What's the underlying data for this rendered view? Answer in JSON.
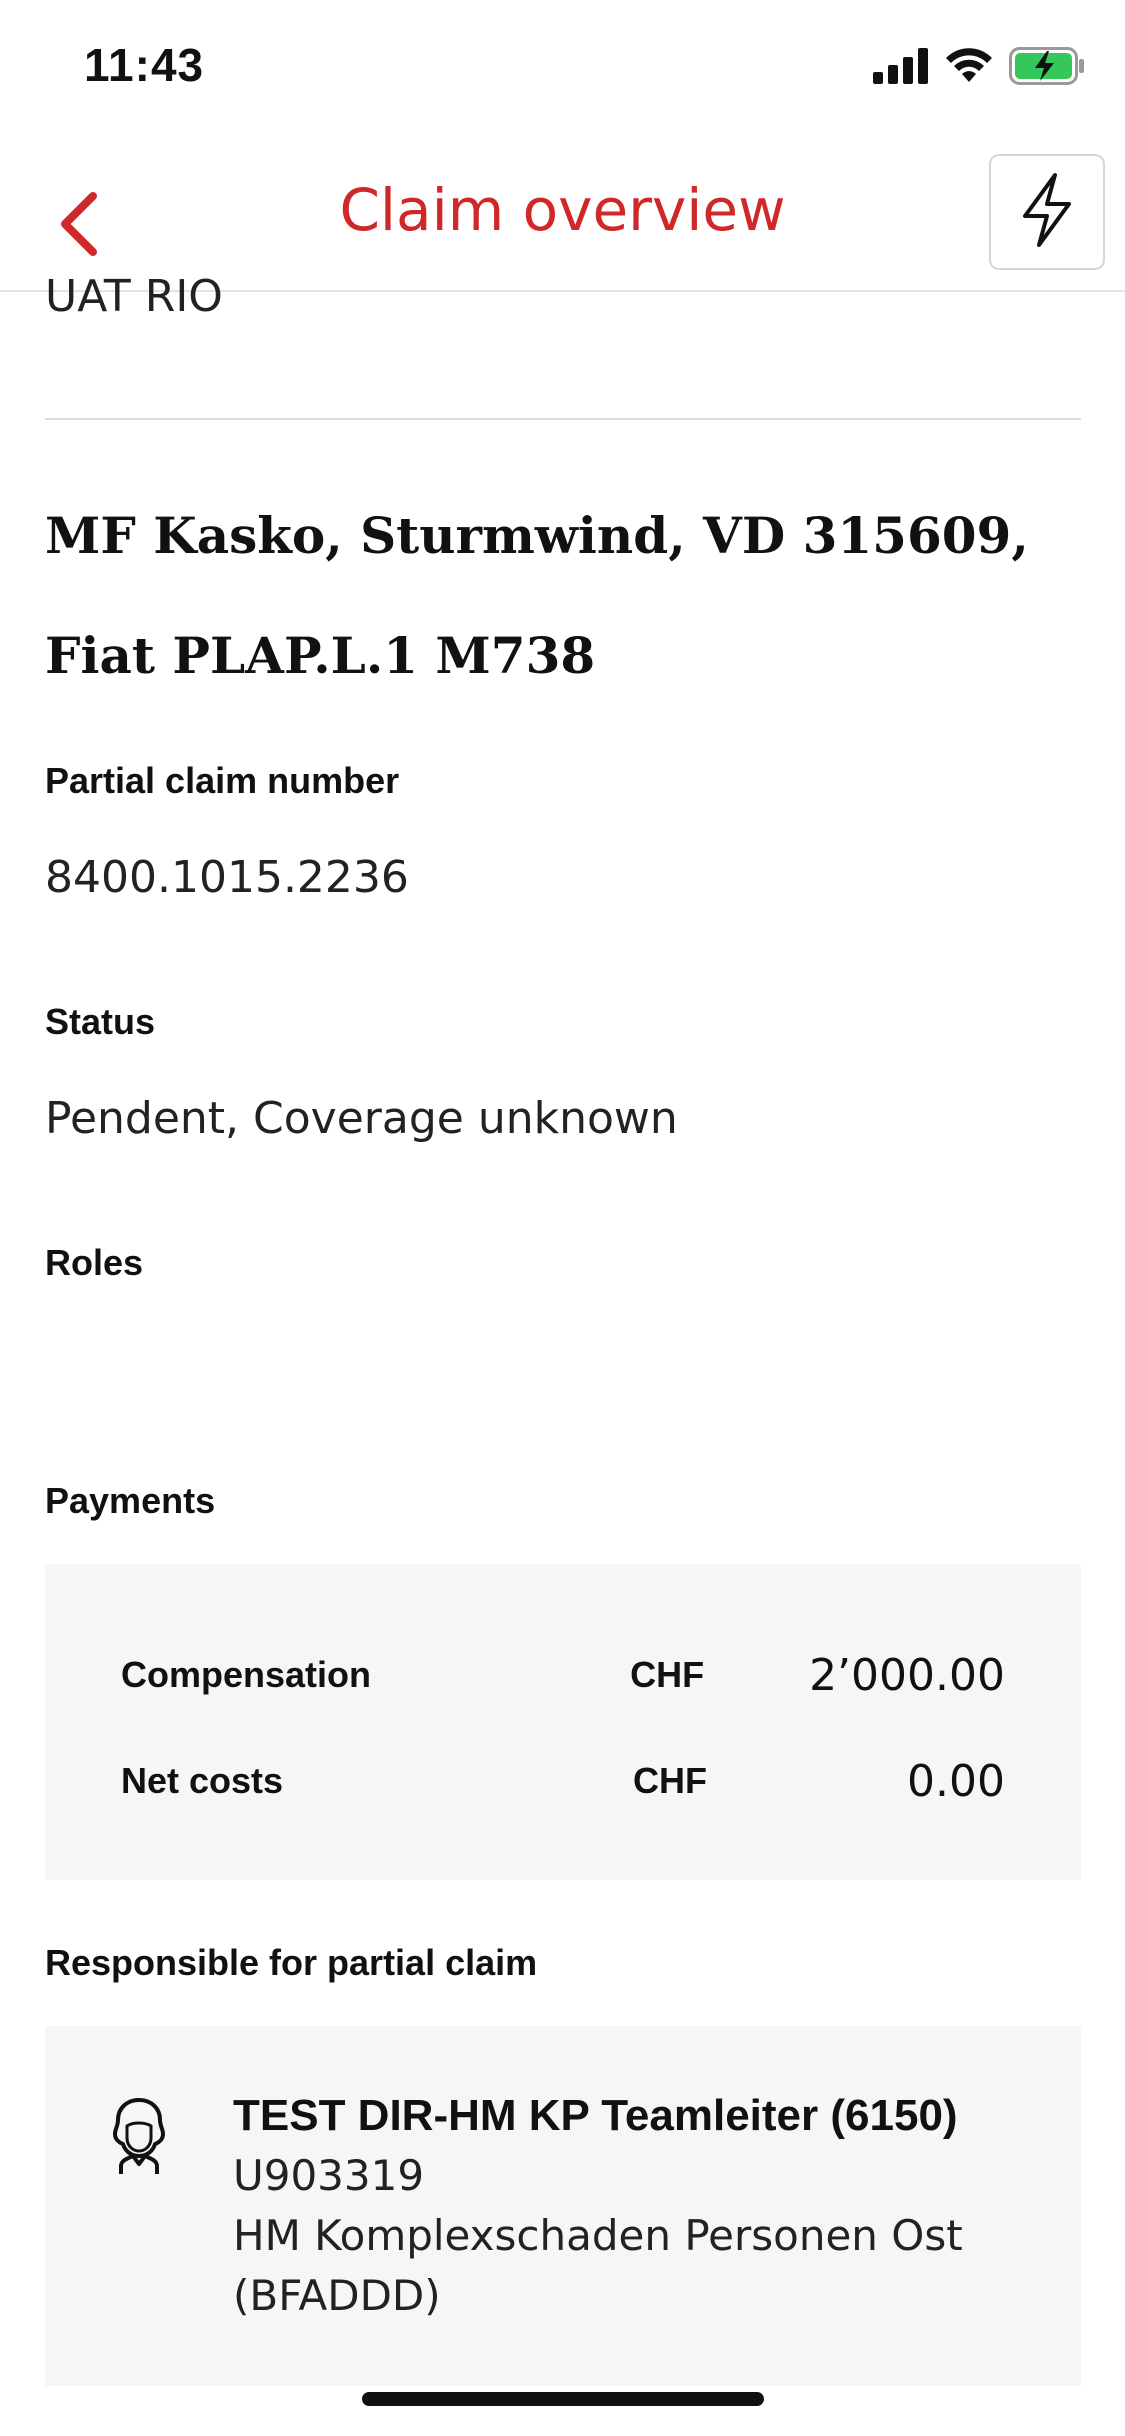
{
  "status_bar": {
    "time": "11:43",
    "icons": [
      "cellular-signal-icon",
      "wifi-icon",
      "battery-charging-icon"
    ]
  },
  "nav": {
    "title": "Claim overview",
    "back_icon": "chevron-left-icon",
    "action_icon": "lightning-bolt-icon"
  },
  "content": {
    "previous_line": "UAT RIO",
    "claim_title": "MF Kasko, Sturmwind, VD 315609, Fiat PLAP.L.1 M738",
    "partial_claim_number": {
      "label": "Partial claim number",
      "value": "8400.1015.2236"
    },
    "status": {
      "label": "Status",
      "value": "Pendent, Coverage unknown"
    },
    "roles": {
      "label": "Roles"
    },
    "payments": {
      "label": "Payments",
      "rows": [
        {
          "label": "Compensation",
          "currency": "CHF",
          "amount": "2’000.00"
        },
        {
          "label": "Net costs",
          "currency": "CHF",
          "amount": "0.00"
        }
      ]
    },
    "responsible": {
      "label": "Responsible for partial claim",
      "name": "TEST DIR-HM KP Teamleiter (6150)",
      "user_id": "U903319",
      "department_line1": "HM Komplexschaden Personen Ost",
      "department_line2": "(BFADDD)",
      "avatar_icon": "person-avatar-icon"
    }
  },
  "colors": {
    "accent": "#d02828",
    "panel_bg": "#f6f6f4",
    "battery_green": "#34c759"
  }
}
